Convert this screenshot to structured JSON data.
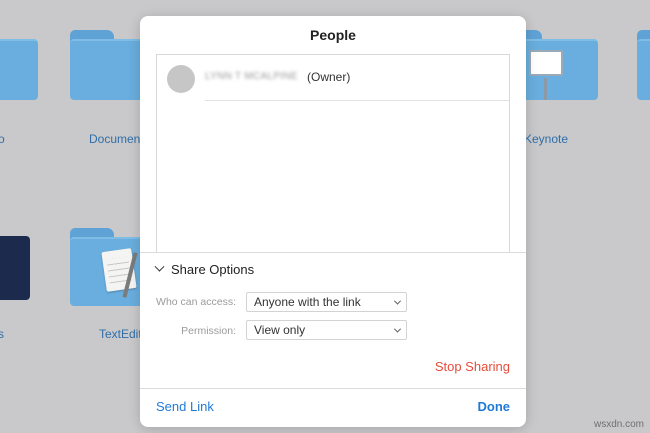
{
  "background": {
    "icons": [
      {
        "label": "o"
      },
      {
        "label": "Documen"
      },
      {
        "label": "Keynote"
      },
      {
        "label": "s"
      },
      {
        "label": "TextEdit"
      }
    ]
  },
  "dialog": {
    "title": "People",
    "owner": {
      "name": "LYNN T MCALPINE",
      "role": "(Owner)"
    },
    "share_options": {
      "label": "Share Options",
      "who_can_access_label": "Who can access:",
      "who_can_access_value": "Anyone with the link",
      "permission_label": "Permission:",
      "permission_value": "View only"
    },
    "stop_sharing": "Stop Sharing",
    "send_link": "Send Link",
    "done": "Done"
  },
  "colors": {
    "accent": "#1f7ad6",
    "destructive": "#e64c3c",
    "folder": "#69aede",
    "backdrop": "#c9c9cb"
  },
  "watermark": "wsxdn.com"
}
